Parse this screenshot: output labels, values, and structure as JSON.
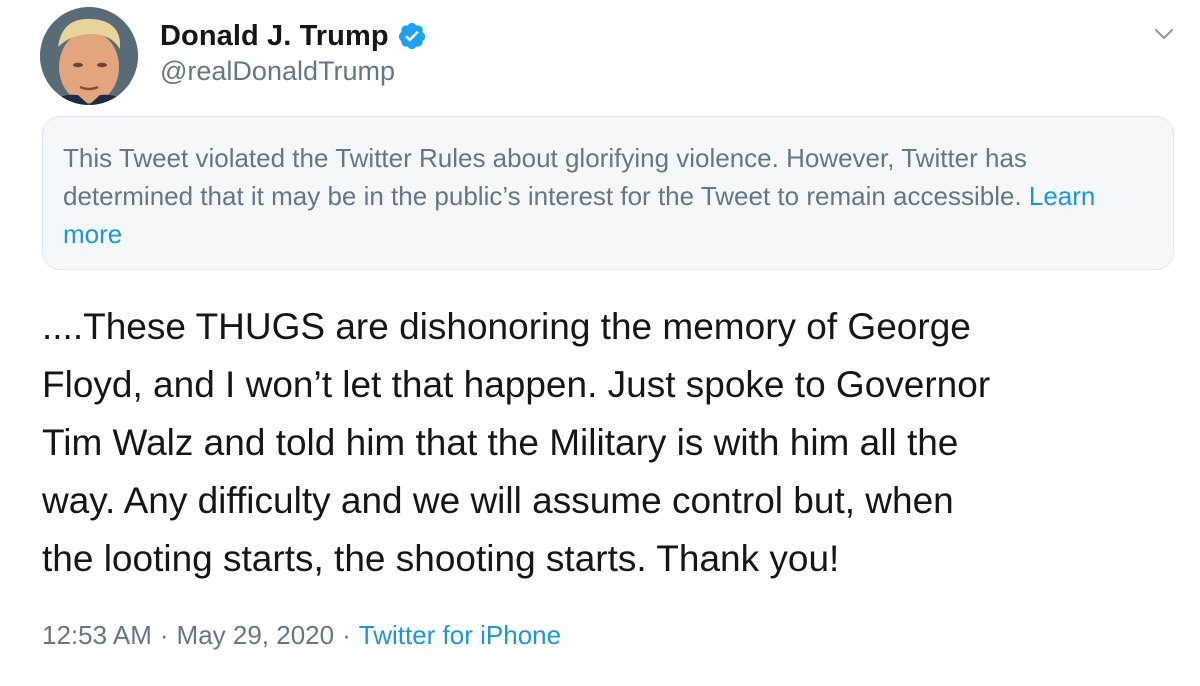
{
  "author": {
    "display_name": "Donald J. Trump",
    "handle": "@realDonaldTrump",
    "verified": true,
    "avatar_icon": "profile-photo"
  },
  "notice": {
    "text": "This Tweet violated the Twitter Rules about glorifying violence. However, Twitter has determined that it may be in the public’s interest for the Tweet to remain accessible.",
    "link_label": "Learn more"
  },
  "tweet": {
    "text_lines": [
      "....These THUGS are dishonoring the memory of George",
      "Floyd, and I won’t let that happen. Just spoke to Governor",
      "Tim Walz and told him that the Military is with him all the",
      "way. Any difficulty and we will assume control but, when",
      "the looting starts, the shooting starts. Thank you!"
    ]
  },
  "meta": {
    "time": "12:53 AM",
    "separator": "·",
    "date": "May 29, 2020",
    "source": "Twitter for iPhone"
  },
  "colors": {
    "accent": "#1b95e0",
    "verified_badge": "#1da1f2",
    "secondary_text": "#657786",
    "notice_background": "#f5f8fa"
  },
  "icons": {
    "verified": "verified-badge-icon",
    "menu": "chevron-down-icon"
  }
}
